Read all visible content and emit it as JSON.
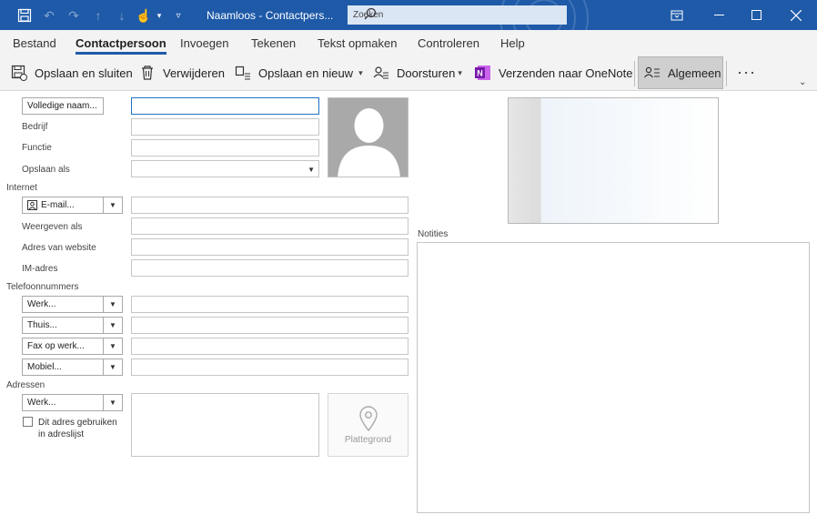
{
  "titlebar": {
    "title": "Naamloos  -  Contactpers...",
    "search_label": "Zoeken",
    "accent": "#1e5aa8"
  },
  "menu": {
    "tabs": [
      "Bestand",
      "Contactpersoon",
      "Invoegen",
      "Tekenen",
      "Tekst opmaken",
      "Controleren",
      "Help"
    ],
    "active": "Contactpersoon"
  },
  "ribbon": {
    "save_close": "Opslaan en sluiten",
    "delete": "Verwijderen",
    "save_new": "Opslaan en nieuw",
    "forward": "Doorsturen",
    "onenote": "Verzenden naar OneNote",
    "general": "Algemeen"
  },
  "form": {
    "full_name_btn": "Volledige naam...",
    "company": "Bedrijf",
    "job_title": "Functie",
    "file_as": "Opslaan als",
    "section_internet": "Internet",
    "email_btn": "E-mail...",
    "display_as": "Weergeven als",
    "website": "Adres van website",
    "im": "IM-adres",
    "section_phones": "Telefoonnummers",
    "phone_work": "Werk...",
    "phone_home": "Thuis...",
    "phone_fax": "Fax op werk...",
    "phone_mobile": "Mobiel...",
    "section_addresses": "Adressen",
    "address_type": "Werk...",
    "mailing_address_line1": "Dit adres gebruiken",
    "mailing_address_line2": "in adreslijst",
    "map": "Plattegrond",
    "notes": "Notities"
  }
}
